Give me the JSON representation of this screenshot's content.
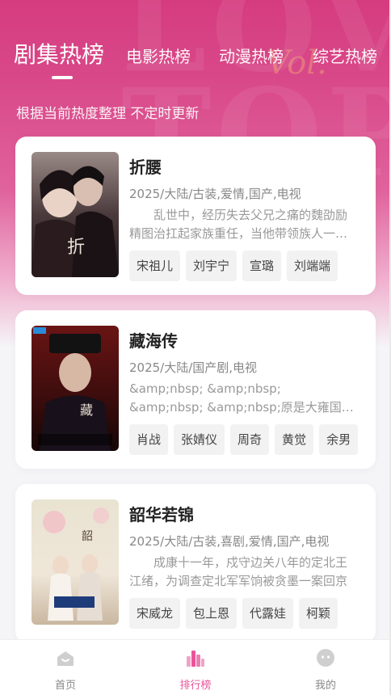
{
  "tabs": [
    {
      "label": "剧集热榜"
    },
    {
      "label": "电影热榜"
    },
    {
      "label": "动漫热榜"
    },
    {
      "label": "综艺热榜"
    }
  ],
  "subtitle": "根据当前热度整理 不定时更新",
  "colors": {
    "accent": "#e8559a",
    "hero_top": "#d53c7f"
  },
  "items": [
    {
      "title": "折腰",
      "meta": "2025/大陆/古装,爱情,国产,电视",
      "desc": "乱世中，经历失去父兄之痛的魏劭励精图治扛起家族重任，当他带领族人一步步走向",
      "tags": [
        "宋祖儿",
        "刘宇宁",
        "宣璐",
        "刘端端"
      ]
    },
    {
      "title": "藏海传",
      "meta": "2025/大陆/国产剧,电视",
      "desc": "&amp;nbsp; &amp;nbsp; &amp;nbsp; &amp;nbsp;原是大雍国钦天监监正蒯铎之子",
      "tags": [
        "肖战",
        "张婧仪",
        "周奇",
        "黄觉",
        "余男"
      ]
    },
    {
      "title": "韶华若锦",
      "meta": "2025/大陆/古装,喜剧,爱情,国产,电视",
      "desc": "成康十一年，戍守边关八年的定北王江绪，为调查定北军军饷被贪墨一案回京",
      "tags": [
        "宋威龙",
        "包上恩",
        "代露娃",
        "柯颖"
      ]
    }
  ],
  "nav": [
    {
      "label": "首页",
      "icon": "home-icon"
    },
    {
      "label": "排行榜",
      "icon": "ranking-icon"
    },
    {
      "label": "我的",
      "icon": "profile-icon"
    }
  ]
}
